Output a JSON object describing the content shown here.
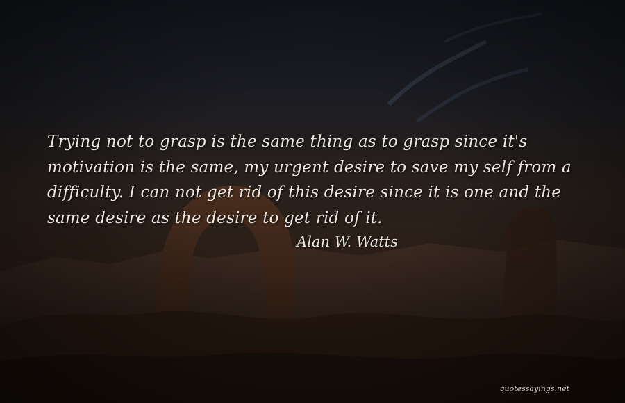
{
  "quote": {
    "text": "Trying not to grasp is the same thing as to grasp since it's motivation is the same, my urgent desire to save my self from a difficulty. I can not get rid of this desire since it is one and the same desire as the desire to get rid of it.",
    "author": "Alan W. Watts"
  },
  "watermark": {
    "text": "quotessayings.net"
  },
  "colors": {
    "text": "#ece6df",
    "sky": "#14171e",
    "rock": "#3a2418"
  }
}
